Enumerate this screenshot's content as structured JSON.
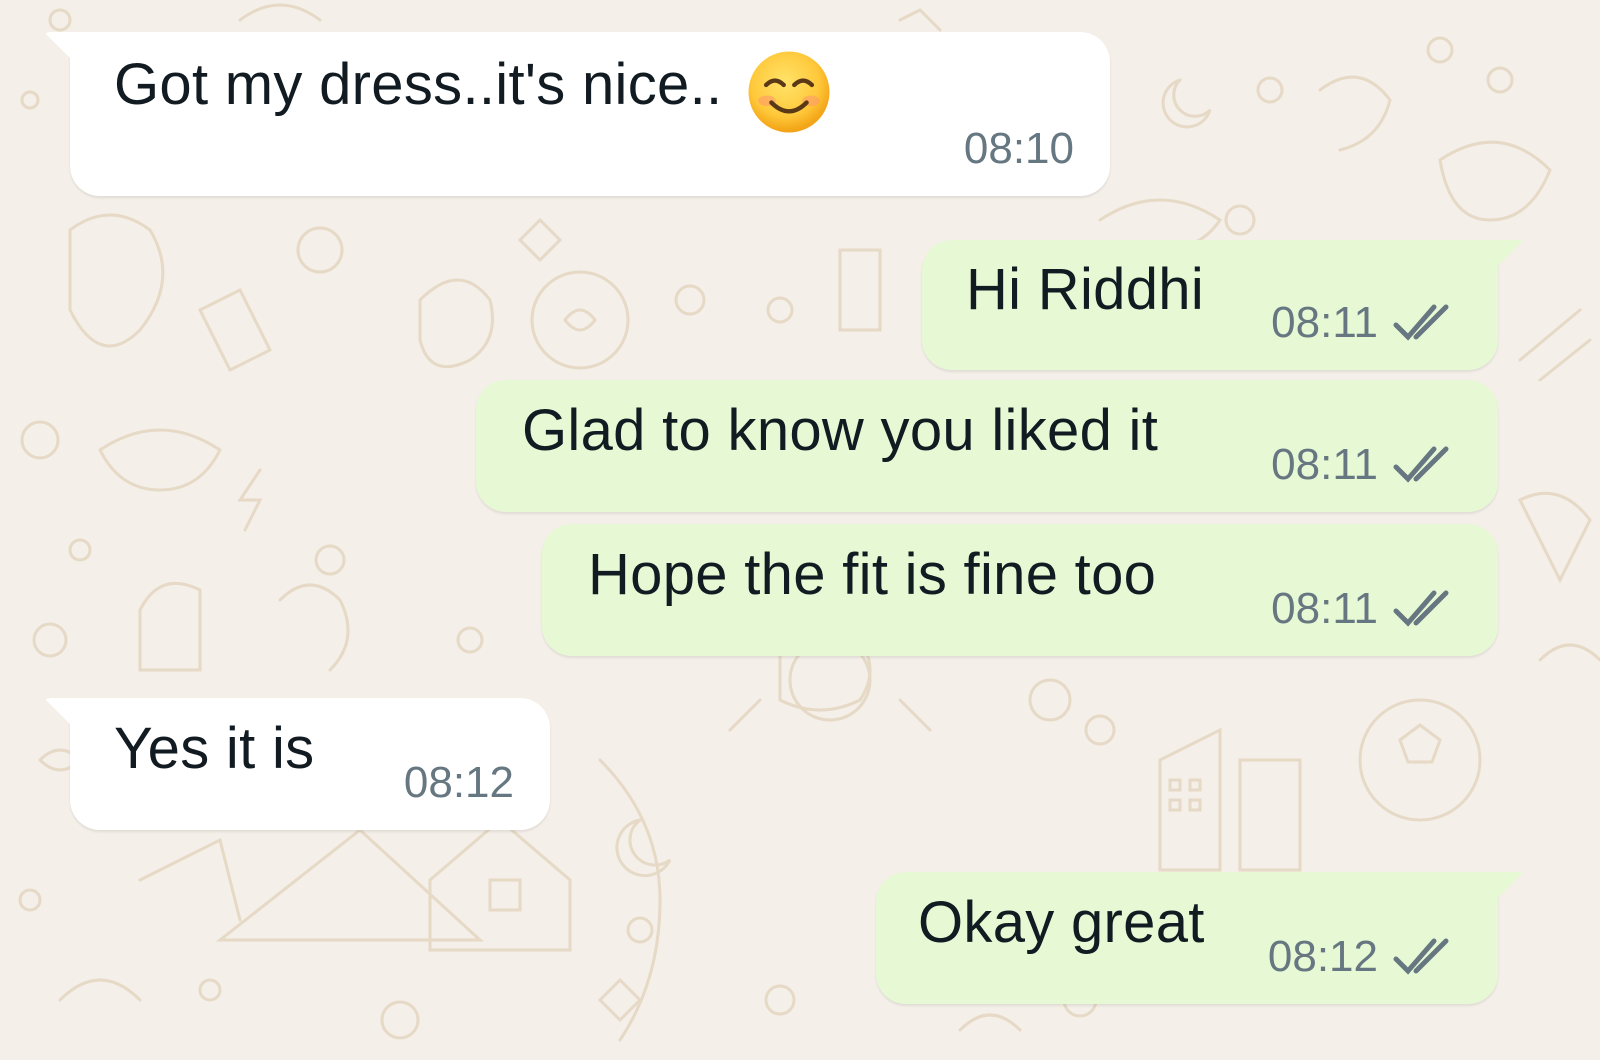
{
  "colors": {
    "incoming_bubble": "#ffffff",
    "outgoing_bubble": "#e7f8d5",
    "background": "#f4efe8",
    "timestamp": "#667781",
    "read_ticks": "#667781"
  },
  "messages": [
    {
      "direction": "incoming",
      "text": "Got my dress..it's nice..",
      "emoji": "smiling-face-with-smiling-eyes",
      "time": "08:10"
    },
    {
      "direction": "outgoing",
      "text": "Hi Riddhi",
      "time": "08:11",
      "status": "read-double-tick"
    },
    {
      "direction": "outgoing",
      "text": "Glad to know you liked it",
      "time": "08:11",
      "status": "read-double-tick"
    },
    {
      "direction": "outgoing",
      "text": "Hope the fit is fine too",
      "time": "08:11",
      "status": "read-double-tick"
    },
    {
      "direction": "incoming",
      "text": "Yes it is",
      "time": "08:12"
    },
    {
      "direction": "outgoing",
      "text": "Okay great",
      "time": "08:12",
      "status": "read-double-tick"
    }
  ]
}
